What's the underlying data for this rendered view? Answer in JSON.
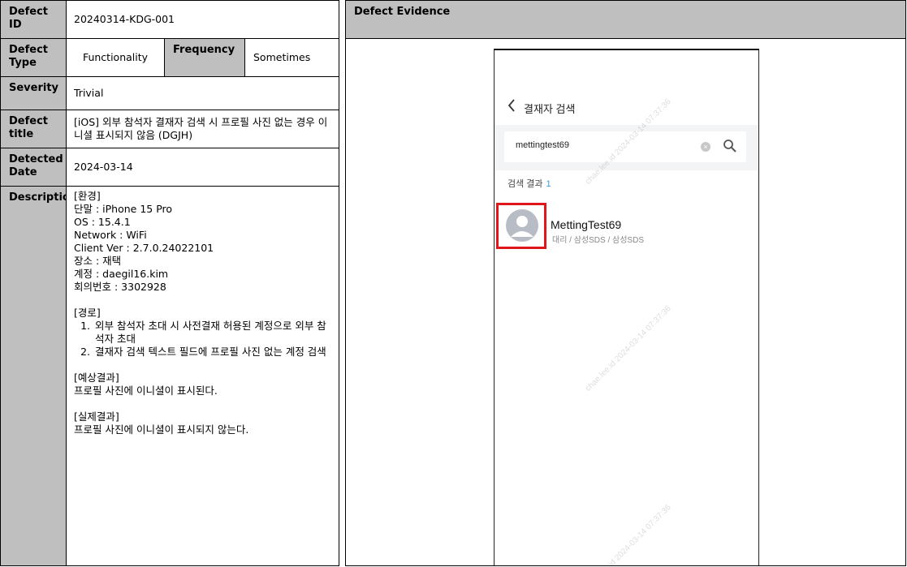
{
  "table": {
    "defect_id": {
      "label": "Defect ID",
      "value": "20240314-KDG-001"
    },
    "defect_type": {
      "label": "Defect Type",
      "value": "Functionality"
    },
    "frequency": {
      "label": "Frequency",
      "value": "Sometimes"
    },
    "severity": {
      "label": "Severity",
      "value": "Trivial"
    },
    "title": {
      "label": "Defect title",
      "value": "[iOS] 외부 참석자 결재자 검색 시 프로필 사진 없는 경우 이니셜 표시되지 않음 (DGJH)"
    },
    "detected_date": {
      "label": "Detected Date",
      "value": "2024-03-14"
    },
    "description": {
      "label": "Description",
      "env_header": "[환경]",
      "env_lines": [
        "단말 : iPhone 15 Pro",
        "OS : 15.4.1",
        "Network : WiFi",
        "Client Ver : 2.7.0.24022101",
        "장소 : 재택",
        "계정 : daegil16.kim",
        "회의번호 : 3302928"
      ],
      "path_header": "[경로]",
      "path_steps": [
        "외부 참석자 초대 시 사전결재 허용된 계정으로 외부 참석자 초대",
        "결재자 검색 텍스트 필드에 프로필 사진 없는 계정 검색"
      ],
      "expected_header": "[예상결과]",
      "expected": "프로필 사진에 이니셜이 표시된다.",
      "actual_header": "[실제결과]",
      "actual": "프로필 사진에 이니셜이 표시되지 않는다."
    }
  },
  "evidence": {
    "header": "Defect Evidence",
    "phone": {
      "nav_title": "결재자 검색",
      "search_value": "mettingtest69",
      "result_label": "검색 결과",
      "result_count": "1",
      "result_name": "MettingTest69",
      "result_sub": "대리 / 삼성SDS / 삼성SDS",
      "watermark": "chae.lee.id 2024-03-14 07:37:36"
    }
  },
  "colors": {
    "header_bg": "#bfbfbf",
    "highlight": "#e0161b",
    "accent": "#3a9fd8"
  },
  "icons": [
    "chevron-left-icon",
    "clear-icon",
    "search-icon",
    "avatar-placeholder-icon"
  ]
}
